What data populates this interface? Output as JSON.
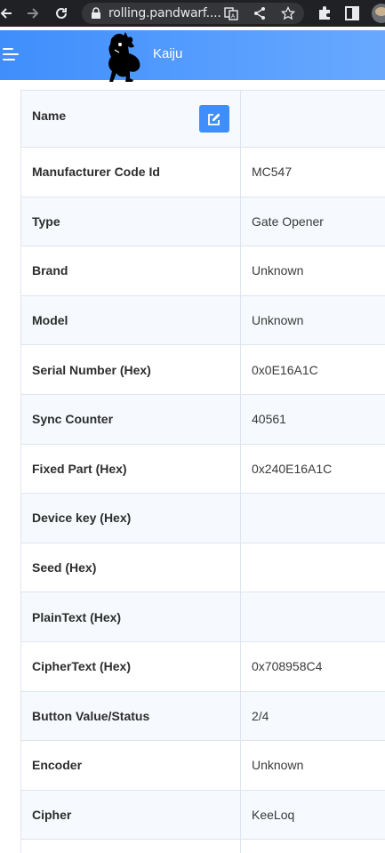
{
  "browser": {
    "url": "rolling.pandwarf...."
  },
  "app": {
    "title": "Kaiju"
  },
  "device_table": {
    "rows": [
      {
        "label": "Name",
        "value": ""
      },
      {
        "label": "Manufacturer Code Id",
        "value": "MC547"
      },
      {
        "label": "Type",
        "value": "Gate Opener"
      },
      {
        "label": "Brand",
        "value": "Unknown"
      },
      {
        "label": "Model",
        "value": "Unknown"
      },
      {
        "label": "Serial Number (Hex)",
        "value": "0x0E16A1C"
      },
      {
        "label": "Sync Counter",
        "value": "40561"
      },
      {
        "label": "Fixed Part (Hex)",
        "value": "0x240E16A1C"
      },
      {
        "label": "Device key (Hex)",
        "value": ""
      },
      {
        "label": "Seed (Hex)",
        "value": ""
      },
      {
        "label": "PlainText (Hex)",
        "value": ""
      },
      {
        "label": "CipherText (Hex)",
        "value": "0x708958C4"
      },
      {
        "label": "Button Value/Status",
        "value": "2/4"
      },
      {
        "label": "Encoder",
        "value": "Unknown"
      },
      {
        "label": "Cipher",
        "value": "KeeLoq"
      },
      {
        "label": "",
        "value": ""
      }
    ]
  },
  "colors": {
    "header_gradient_start": "#3f8efc",
    "header_gradient_end": "#68a9ff",
    "edit_button": "#3f8efc",
    "chrome_bg": "#202124"
  },
  "icons": {
    "back": "arrow-left-icon",
    "forward": "arrow-right-icon",
    "reload": "reload-icon",
    "lock": "lock-icon",
    "translate": "translate-icon",
    "share": "share-icon",
    "bookmark": "star-icon",
    "extensions": "puzzle-icon",
    "sidepanel": "sidepanel-icon",
    "profile": "avatar",
    "menu": "hamburger-menu-icon",
    "edit": "edit-icon"
  }
}
